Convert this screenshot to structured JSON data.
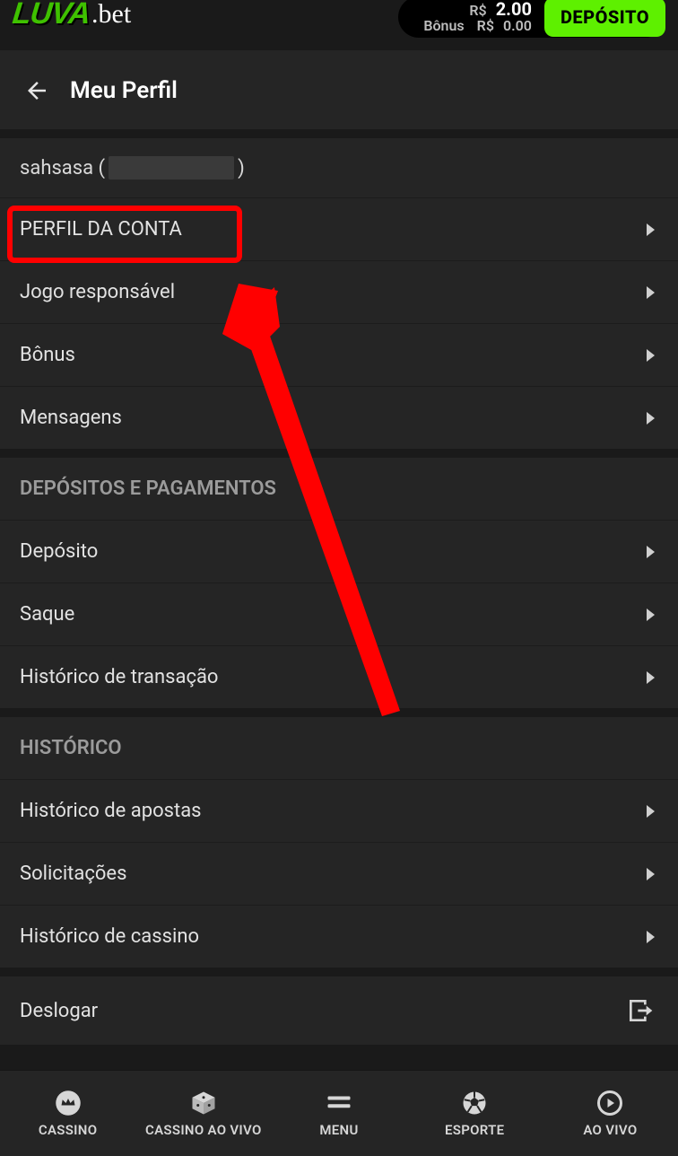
{
  "header": {
    "logo_main": "LUVA",
    "logo_suffix": ".bet",
    "balance_currency": "R$",
    "balance_value": "2.00",
    "bonus_label": "Bônus",
    "bonus_currency": "R$",
    "bonus_value": "0.00",
    "deposit_button": "DEPÓSITO"
  },
  "page": {
    "title": "Meu Perfil",
    "username": "sahsasa"
  },
  "sections": [
    {
      "items": [
        {
          "label": "PERFIL DA CONTA",
          "highlighted": true
        },
        {
          "label": "Jogo responsável"
        },
        {
          "label": "Bônus"
        },
        {
          "label": "Mensagens"
        }
      ]
    },
    {
      "header": "DEPÓSITOS E PAGAMENTOS",
      "items": [
        {
          "label": "Depósito"
        },
        {
          "label": "Saque"
        },
        {
          "label": "Histórico de transação"
        }
      ]
    },
    {
      "header": "HISTÓRICO",
      "items": [
        {
          "label": "Histórico de apostas"
        },
        {
          "label": "Solicitações"
        },
        {
          "label": "Histórico de cassino"
        }
      ]
    }
  ],
  "logoff": "Deslogar",
  "bottom_nav": {
    "cassino": "CASSINO",
    "cassino_vivo": "CASSINO AO VIVO",
    "menu": "MENU",
    "esporte": "ESPORTE",
    "aovivo": "AO VIVO"
  },
  "colors": {
    "accent": "#5ef000",
    "bg": "#252525",
    "bg_dark": "#1a1a1a",
    "annotation": "#ff0000"
  }
}
